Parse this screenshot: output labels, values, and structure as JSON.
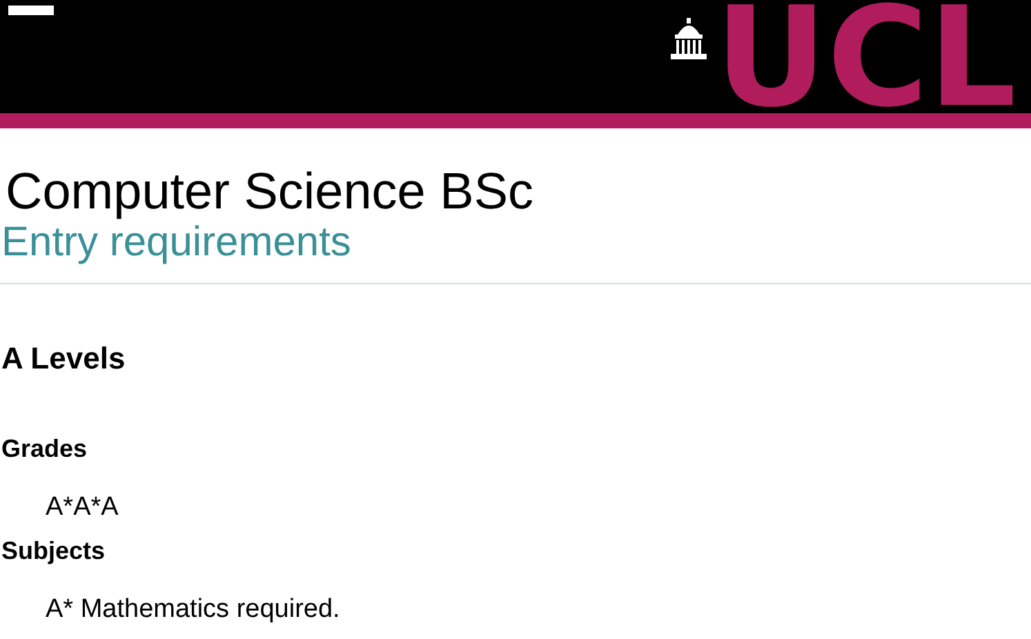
{
  "header": {
    "logo": "UCL"
  },
  "title": "Computer Science BSc",
  "subtitle": "Entry requirements",
  "section": {
    "heading": "A Levels",
    "fields": [
      {
        "label": "Grades",
        "value": "A*A*A"
      },
      {
        "label": "Subjects",
        "value": "A* Mathematics required."
      }
    ]
  }
}
